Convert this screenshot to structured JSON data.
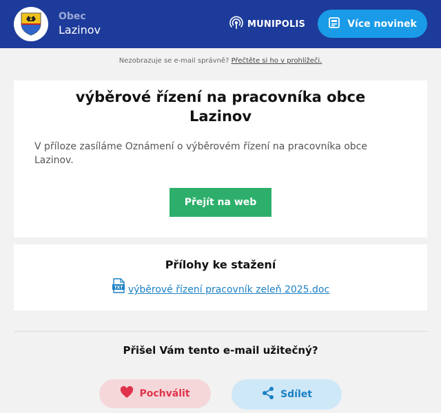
{
  "header": {
    "town_label": "Obec",
    "town_name": "Lazinov",
    "brand": "MUNIPOLIS",
    "news_button": "Více novinek",
    "bg_color": "#1d3b9a"
  },
  "preheader": {
    "text": "Nezobrazuje se e-mail správně?",
    "link": "Přečtěte si ho v prohlížeči."
  },
  "article": {
    "title": "výběrové řízení na pracovníka obce Lazinov",
    "body": "V příloze zasíláme Oznámení o výběrovém řízení na pracovníka obce Lazinov.",
    "web_button": "Přejít na web"
  },
  "attachments": {
    "heading": "Přílohy ke stažení",
    "items": [
      {
        "name": "výběrové řízení pracovník zeleň 2025.doc",
        "icon": "txt-file-icon"
      }
    ]
  },
  "feedback": {
    "question": "Přišel Vám tento e-mail užitečný?",
    "praise_button": "Pochválit",
    "share_button": "Sdílet"
  },
  "colors": {
    "accent_blue": "#1a9be8",
    "green": "#2daf6b",
    "praise_red": "#e0334b",
    "link_blue": "#1a7fc4"
  }
}
